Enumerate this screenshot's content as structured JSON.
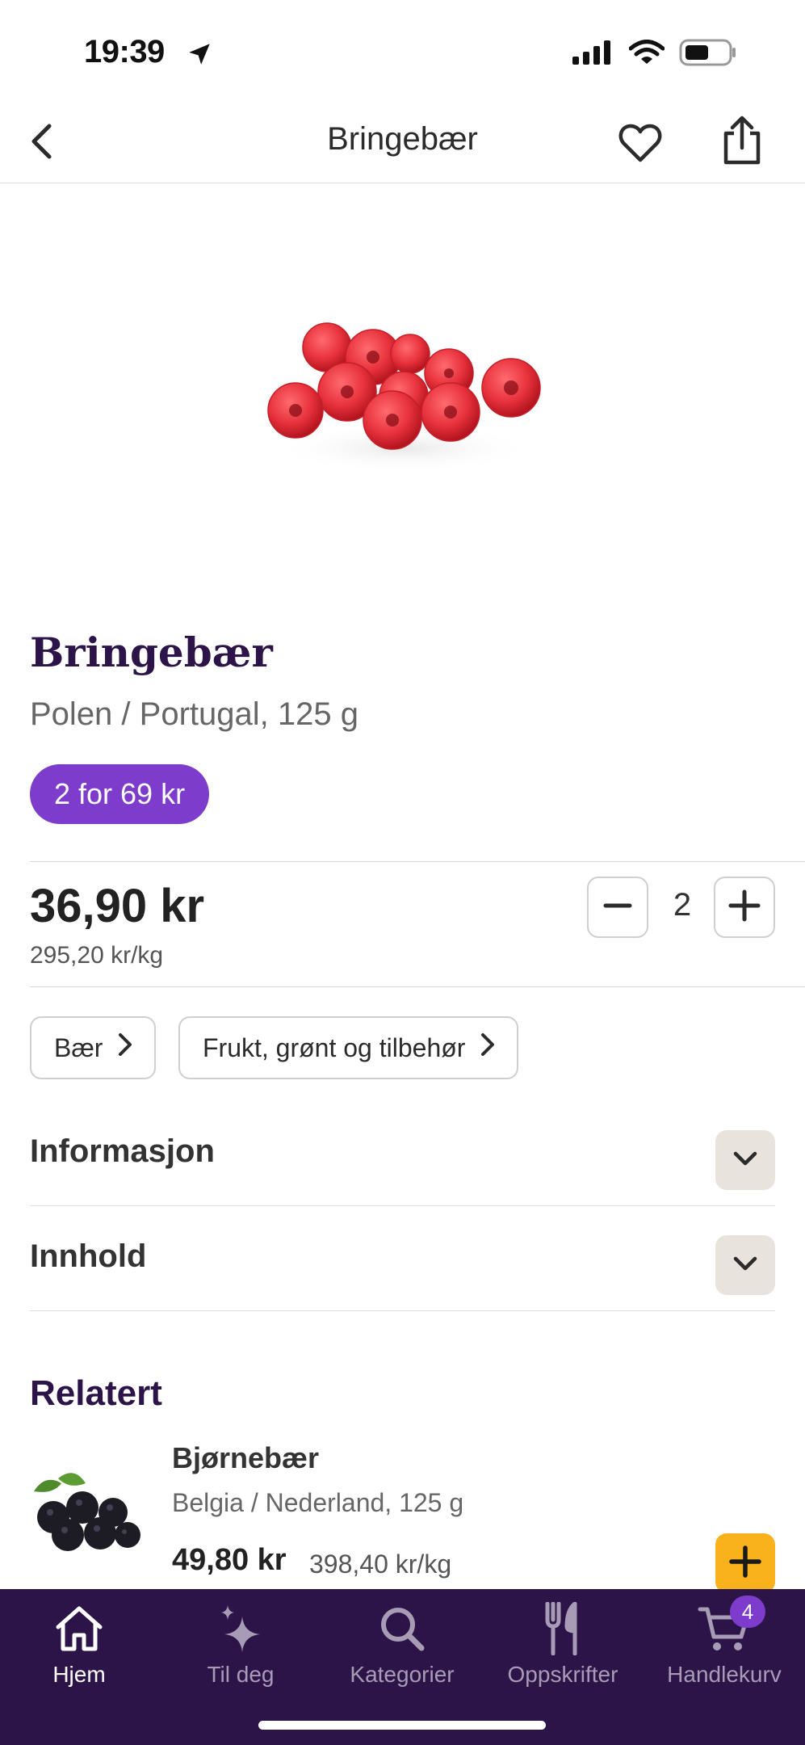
{
  "status_bar": {
    "time": "19:39"
  },
  "nav": {
    "title": "Bringebær"
  },
  "product": {
    "name": "Bringebær",
    "origin": "Polen / Portugal, 125 g",
    "promo": "2 for 69 kr",
    "price": "36,90 kr",
    "unit_price": "295,20 kr/kg",
    "quantity": "2"
  },
  "categories": [
    {
      "label": "Bær"
    },
    {
      "label": "Frukt, grønt og tilbehør"
    }
  ],
  "accordion": {
    "info_label": "Informasjon",
    "content_label": "Innhold"
  },
  "related": {
    "title": "Relatert",
    "items": [
      {
        "name": "Bjørnebær",
        "origin": "Belgia / Nederland, 125 g",
        "price": "49,80 kr",
        "unit_price": "398,40 kr/kg"
      }
    ]
  },
  "tabs": [
    {
      "label": "Hjem",
      "icon": "home-icon",
      "active": true
    },
    {
      "label": "Til deg",
      "icon": "sparkle-icon",
      "active": false
    },
    {
      "label": "Kategorier",
      "icon": "search-icon",
      "active": false
    },
    {
      "label": "Oppskrifter",
      "icon": "cutlery-icon",
      "active": false
    },
    {
      "label": "Handlekurv",
      "icon": "cart-icon",
      "active": false,
      "badge": "4"
    }
  ],
  "colors": {
    "brand_dark": "#2d1448",
    "promo_purple": "#7d3ccb",
    "add_button_yellow": "#f9b21c",
    "accordion_toggle_bg": "#e8e4dd"
  }
}
